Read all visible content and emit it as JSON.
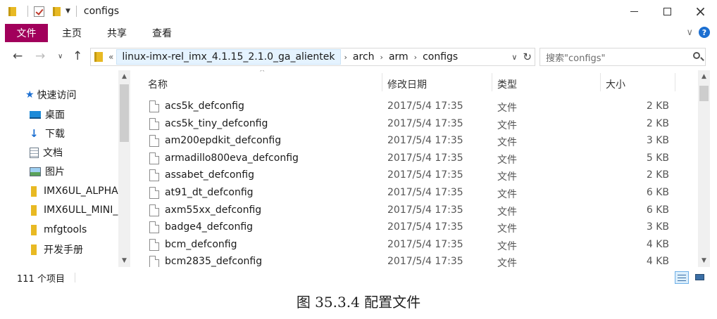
{
  "window": {
    "title": "configs",
    "controls": {
      "minimize": "—",
      "maximize": "☐",
      "close": "×"
    }
  },
  "ribbon": {
    "file_tab": "文件",
    "tabs": [
      "主页",
      "共享",
      "查看"
    ],
    "help": "?"
  },
  "address": {
    "overflow": "«",
    "crumbs": [
      "linux-imx-rel_imx_4.1.15_2.1.0_ga_alientek",
      "arch",
      "arm",
      "configs"
    ],
    "search_placeholder": "搜索\"configs\""
  },
  "nav": {
    "quick_access": "快速访问",
    "items": [
      {
        "label": "桌面",
        "icon": "desktop-icon",
        "pinned": true
      },
      {
        "label": "下载",
        "icon": "download-icon",
        "pinned": true
      },
      {
        "label": "文档",
        "icon": "documents-icon",
        "pinned": true
      },
      {
        "label": "图片",
        "icon": "pictures-icon",
        "pinned": true
      },
      {
        "label": "IMX6UL_ALPHA",
        "icon": "folder-icon",
        "pinned": false
      },
      {
        "label": "IMX6ULL_MINI_",
        "icon": "folder-icon",
        "pinned": false
      },
      {
        "label": "mfgtools",
        "icon": "folder-icon",
        "pinned": false
      },
      {
        "label": "开发手册",
        "icon": "folder-icon",
        "pinned": false
      }
    ]
  },
  "columns": {
    "name": "名称",
    "date": "修改日期",
    "type": "类型",
    "size": "大小"
  },
  "files": [
    {
      "name": "acs5k_defconfig",
      "date": "2017/5/4 17:35",
      "type": "文件",
      "size": "2 KB"
    },
    {
      "name": "acs5k_tiny_defconfig",
      "date": "2017/5/4 17:35",
      "type": "文件",
      "size": "2 KB"
    },
    {
      "name": "am200epdkit_defconfig",
      "date": "2017/5/4 17:35",
      "type": "文件",
      "size": "3 KB"
    },
    {
      "name": "armadillo800eva_defconfig",
      "date": "2017/5/4 17:35",
      "type": "文件",
      "size": "5 KB"
    },
    {
      "name": "assabet_defconfig",
      "date": "2017/5/4 17:35",
      "type": "文件",
      "size": "2 KB"
    },
    {
      "name": "at91_dt_defconfig",
      "date": "2017/5/4 17:35",
      "type": "文件",
      "size": "6 KB"
    },
    {
      "name": "axm55xx_defconfig",
      "date": "2017/5/4 17:35",
      "type": "文件",
      "size": "6 KB"
    },
    {
      "name": "badge4_defconfig",
      "date": "2017/5/4 17:35",
      "type": "文件",
      "size": "3 KB"
    },
    {
      "name": "bcm_defconfig",
      "date": "2017/5/4 17:35",
      "type": "文件",
      "size": "4 KB"
    },
    {
      "name": "bcm2835_defconfig",
      "date": "2017/5/4 17:35",
      "type": "文件",
      "size": "4 KB"
    }
  ],
  "status": {
    "item_count": "111 个项目"
  },
  "caption": "图 35.3.4  配置文件",
  "colors": {
    "file_tab": "#a1005b",
    "folder": "#e8b923",
    "selection": "#e5f3ff",
    "help": "#1c6fd1"
  }
}
